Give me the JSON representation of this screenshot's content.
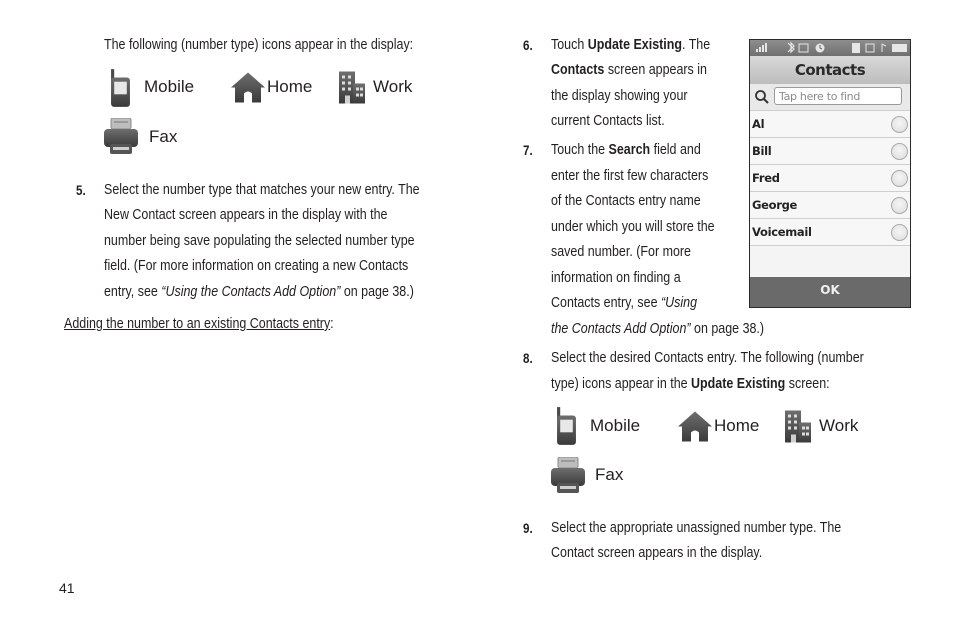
{
  "page_number": "41",
  "left_column": {
    "intro": "The following (number type) icons appear in the display:",
    "icons": [
      {
        "icon": "mobile-phone-icon",
        "label": "Mobile"
      },
      {
        "icon": "home-icon",
        "label": "Home"
      },
      {
        "icon": "work-building-icon",
        "label": "Work"
      },
      {
        "icon": "fax-icon",
        "label": "Fax"
      }
    ],
    "step5": {
      "number": "5.",
      "lines": [
        "Select the number type that matches your new entry. The",
        "New Contact screen appears in the display with the",
        "number being save populating the selected number type",
        "field. (For more information on creating a new Contacts"
      ],
      "last_line_prefix": "entry, see ",
      "last_line_link": "“Using the Contacts Add Option”",
      "last_line_suffix": " on page 38.)"
    },
    "heading": "Adding the number to an existing Contacts entry",
    "heading_colon": ":"
  },
  "right_column": {
    "step6": {
      "number": "6.",
      "l1_pre": "Touch ",
      "l1_bold": "Update Existing",
      "l1_post": ". The",
      "l2_bold": "Contacts",
      "l2_post": " screen appears in",
      "l3": "the display showing your",
      "l4": "current Contacts list."
    },
    "step7": {
      "number": "7.",
      "l1_pre": "Touch the ",
      "l1_bold": "Search",
      "l1_post": " field and",
      "lines": [
        "enter the first few characters",
        "of the Contacts entry name",
        "under which you will store the",
        "saved number. (For more",
        "information on finding a"
      ],
      "l7_pre": "Contacts entry, see ",
      "l7_italic": "“Using",
      "l8_italic": "the Contacts Add Option”",
      "l8_post": " on page 38.)"
    },
    "step8": {
      "number": "8.",
      "l1": "Select the desired Contacts entry. The following (number",
      "l2_pre": "type) icons appear in the ",
      "l2_bold": "Update Existing",
      "l2_post": " screen:"
    },
    "icons": [
      {
        "icon": "mobile-phone-icon",
        "label": "Mobile"
      },
      {
        "icon": "home-icon",
        "label": "Home"
      },
      {
        "icon": "work-building-icon",
        "label": "Work"
      },
      {
        "icon": "fax-icon",
        "label": "Fax"
      }
    ],
    "step9": {
      "number": "9.",
      "l1": "Select the appropriate unassigned number type. The",
      "l2": "Contact screen appears in the display."
    }
  },
  "phone_screen": {
    "title": "Contacts",
    "search_placeholder": "Tap here to find",
    "contacts": [
      "Al",
      "Bill",
      "Fred",
      "George",
      "Voicemail"
    ],
    "ok_label": "OK",
    "status_icons": [
      "signal-icon",
      "bluetooth-icon",
      "message-icon",
      "clock-icon",
      "memory-card-icon",
      "sim-icon",
      "music-icon",
      "battery-icon"
    ]
  }
}
